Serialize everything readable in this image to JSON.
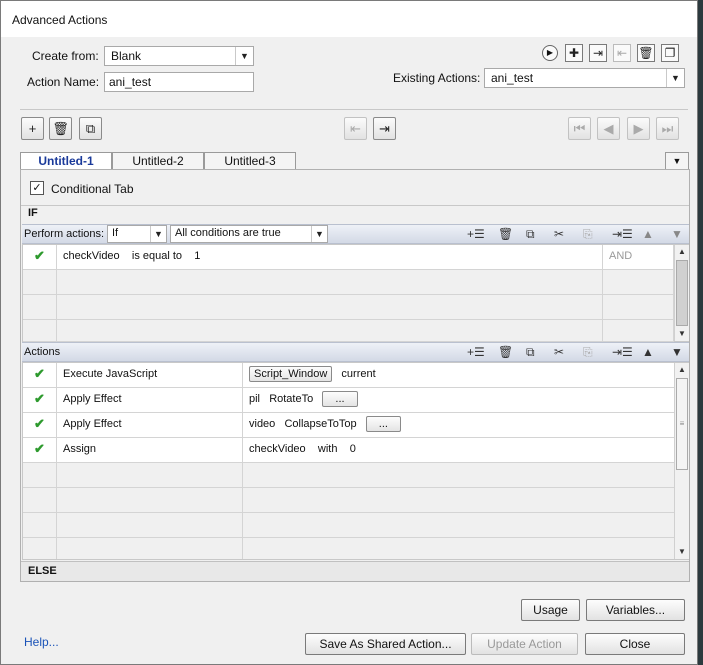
{
  "window": {
    "title": "Advanced Actions"
  },
  "top": {
    "create_from_label": "Create from:",
    "create_from_value": "Blank",
    "action_name_label": "Action Name:",
    "action_name_value": "ani_test",
    "existing_actions_label": "Existing Actions:",
    "existing_actions_value": "ani_test"
  },
  "tabs": [
    {
      "label": "Untitled-1",
      "active": true
    },
    {
      "label": "Untitled-2",
      "active": false
    },
    {
      "label": "Untitled-3",
      "active": false
    }
  ],
  "conditional_tab": {
    "label": "Conditional Tab",
    "checked": true
  },
  "if_section": {
    "label": "IF",
    "perform_actions_label": "Perform actions:",
    "perform_actions_value": "If",
    "conditions_value": "All conditions are true",
    "rows": [
      {
        "variable": "checkVideo",
        "operator": "is equal to",
        "value": "1",
        "logic": "AND"
      }
    ]
  },
  "actions_section": {
    "label": "Actions",
    "rows": [
      {
        "action": "Execute JavaScript",
        "button": "Script_Window",
        "target": "current"
      },
      {
        "action": "Apply Effect",
        "target": "pil",
        "effect": "RotateTo",
        "more": "..."
      },
      {
        "action": "Apply Effect",
        "target": "video",
        "effect": "CollapseToTop",
        "more": "..."
      },
      {
        "action": "Assign",
        "target": "checkVideo",
        "with_label": "with",
        "value": "0"
      }
    ]
  },
  "else_section": {
    "label": "ELSE"
  },
  "buttons": {
    "usage": "Usage",
    "variables": "Variables...",
    "help": "Help...",
    "save_shared": "Save As Shared Action...",
    "update": "Update Action",
    "close": "Close"
  },
  "colors": {
    "check": "#2e9a2e",
    "link": "#1a53b8",
    "active_tab": "#1a3a9a"
  }
}
